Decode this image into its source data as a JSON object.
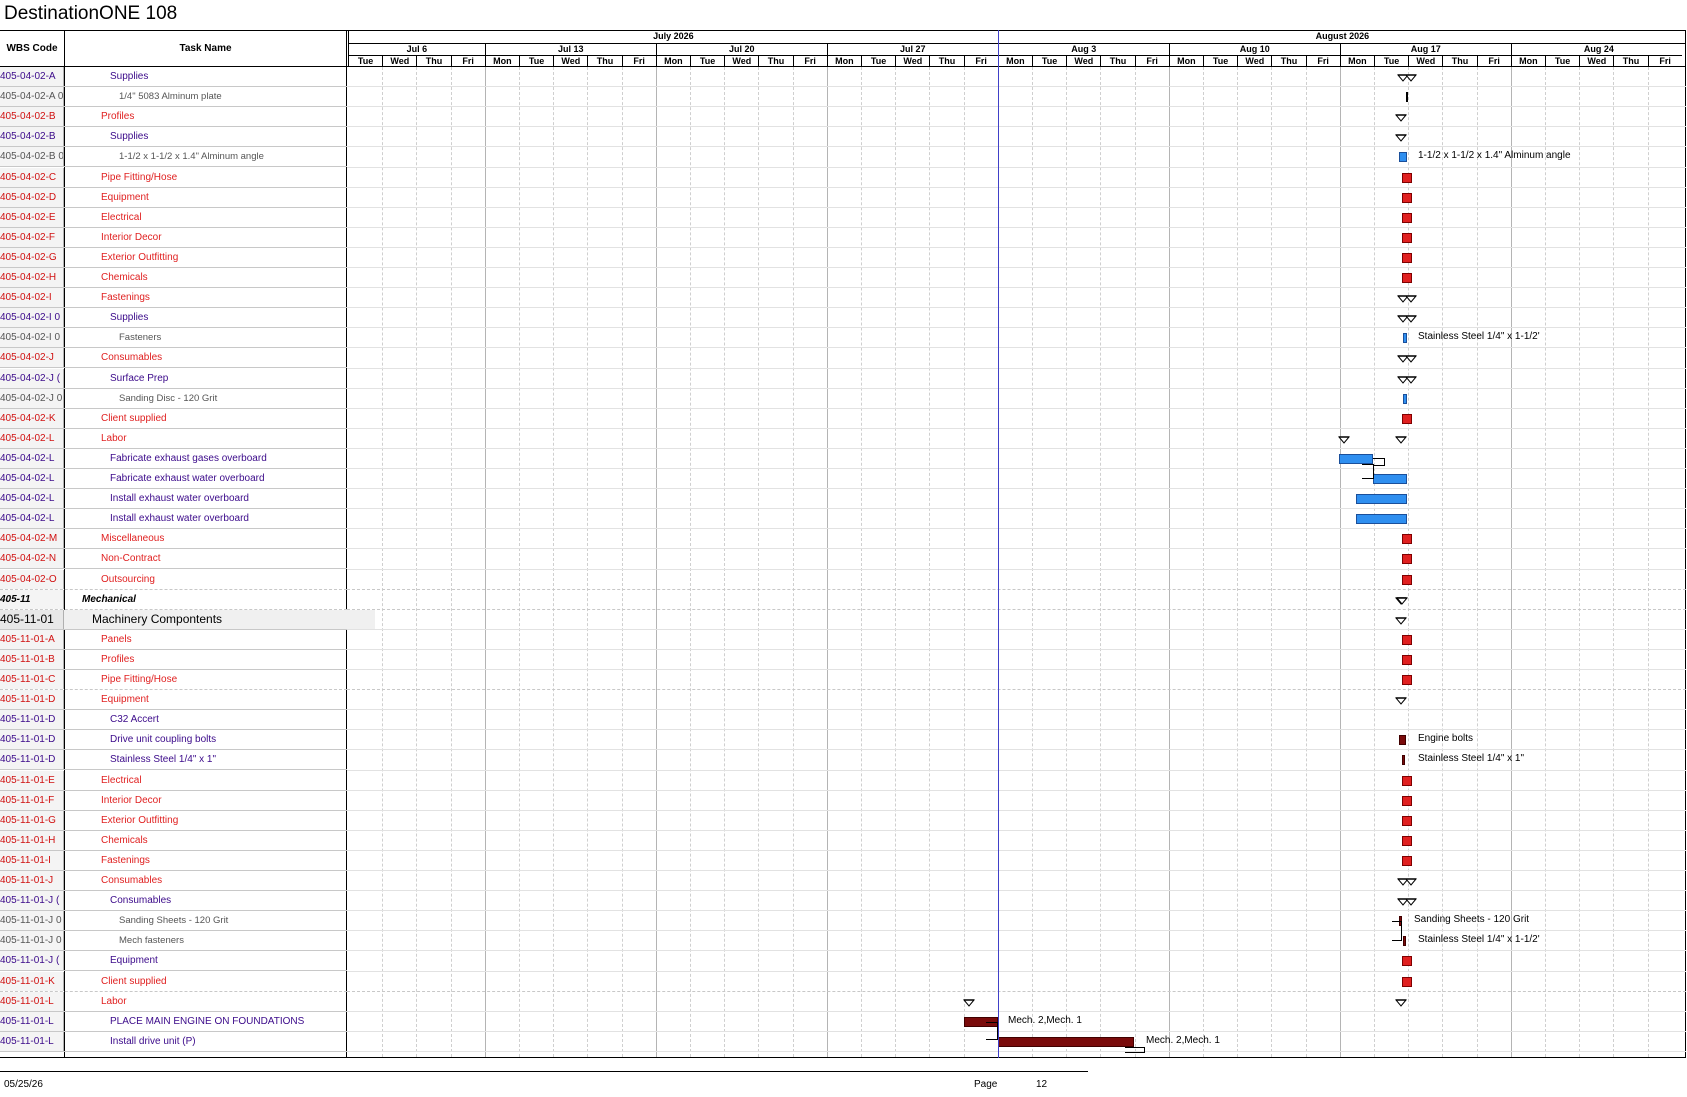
{
  "document": {
    "title": "DestinationONE 108"
  },
  "columns": {
    "wbs": "WBS Code",
    "task": "Task Name"
  },
  "timescale": {
    "months": [
      "July 2026",
      "August 2026"
    ],
    "weeks": [
      "Jul 6",
      "Jul 13",
      "Jul 20",
      "Jul 27",
      "Aug 3",
      "Aug 10",
      "Aug 17",
      "Aug 24"
    ],
    "days": [
      "Tue",
      "Wed",
      "Thu",
      "Fri",
      "Mon",
      "Tue",
      "Wed",
      "Thu",
      "Fri",
      "Mon",
      "Tue",
      "Wed",
      "Thu",
      "Fri",
      "Mon",
      "Tue",
      "Wed",
      "Thu",
      "Fri",
      "Mon",
      "Tue",
      "Wed",
      "Thu",
      "Fri",
      "Mon",
      "Tue",
      "Wed",
      "Thu",
      "Fri",
      "Mon",
      "Tue",
      "Wed",
      "Thu",
      "Fri",
      "Mon",
      "Tue",
      "Wed",
      "Thu",
      "Fri"
    ]
  },
  "colors": {
    "red_task": "#e02020",
    "purple_task": "#3b0a8a",
    "gray_task": "#555555",
    "blue_bar": "#2f8ff0",
    "dark_red_bar": "#7a0b0b",
    "today_line": "#4040c8"
  },
  "rows": [
    {
      "wbs": "405-04-02-A",
      "name": "Supplies",
      "style": "purple",
      "lvl": 2
    },
    {
      "wbs": "405-04-02-A 0",
      "name": "1/4\" 5083 Alminum plate",
      "style": "gray",
      "lvl": 3
    },
    {
      "wbs": "405-04-02-B",
      "name": "Profiles",
      "style": "red",
      "lvl": 1
    },
    {
      "wbs": "405-04-02-B",
      "name": "Supplies",
      "style": "purple",
      "lvl": 2
    },
    {
      "wbs": "405-04-02-B 0",
      "name": "1-1/2 x 1-1/2 x 1.4\" Alminum angle",
      "style": "gray",
      "lvl": 3
    },
    {
      "wbs": "405-04-02-C",
      "name": "Pipe Fitting/Hose",
      "style": "red",
      "lvl": 1
    },
    {
      "wbs": "405-04-02-D",
      "name": "Equipment",
      "style": "red",
      "lvl": 1
    },
    {
      "wbs": "405-04-02-E",
      "name": "Electrical",
      "style": "red",
      "lvl": 1
    },
    {
      "wbs": "405-04-02-F",
      "name": "Interior Decor",
      "style": "red",
      "lvl": 1
    },
    {
      "wbs": "405-04-02-G",
      "name": "Exterior Outfitting",
      "style": "red",
      "lvl": 1
    },
    {
      "wbs": "405-04-02-H",
      "name": "Chemicals",
      "style": "red",
      "lvl": 1
    },
    {
      "wbs": "405-04-02-I",
      "name": "Fastenings",
      "style": "red",
      "lvl": 1
    },
    {
      "wbs": "405-04-02-I 0",
      "name": "Supplies",
      "style": "purple",
      "lvl": 2
    },
    {
      "wbs": "405-04-02-I 0",
      "name": "Fasteners",
      "style": "gray",
      "lvl": 3
    },
    {
      "wbs": "405-04-02-J",
      "name": "Consumables",
      "style": "red",
      "lvl": 1
    },
    {
      "wbs": "405-04-02-J (",
      "name": "Surface Prep",
      "style": "purple",
      "lvl": 2
    },
    {
      "wbs": "405-04-02-J 0",
      "name": "Sanding Disc - 120 Grit",
      "style": "gray",
      "lvl": 3
    },
    {
      "wbs": "405-04-02-K",
      "name": "Client supplied",
      "style": "red",
      "lvl": 1
    },
    {
      "wbs": "405-04-02-L",
      "name": "Labor",
      "style": "red",
      "lvl": 1
    },
    {
      "wbs": "405-04-02-L",
      "name": "Fabricate exhaust gases overboard",
      "style": "purple",
      "lvl": 2
    },
    {
      "wbs": "405-04-02-L",
      "name": "Fabricate exhaust water overboard",
      "style": "purple",
      "lvl": 2
    },
    {
      "wbs": "405-04-02-L",
      "name": "Install exhaust water overboard",
      "style": "purple",
      "lvl": 2
    },
    {
      "wbs": "405-04-02-L",
      "name": "Install exhaust water overboard",
      "style": "purple",
      "lvl": 2
    },
    {
      "wbs": "405-04-02-M",
      "name": "Miscellaneous",
      "style": "red",
      "lvl": 1
    },
    {
      "wbs": "405-04-02-N",
      "name": "Non-Contract",
      "style": "red",
      "lvl": 1
    },
    {
      "wbs": "405-04-02-O",
      "name": "Outsourcing",
      "style": "red",
      "lvl": 1
    },
    {
      "wbs": "405-11",
      "name": "Mechanical",
      "style": "bolditalic",
      "lvl": 0
    },
    {
      "wbs": "405-11-01",
      "name": "Machinery Compontents",
      "style": "large",
      "lvl": 0
    },
    {
      "wbs": "405-11-01-A",
      "name": "Panels",
      "style": "red",
      "lvl": 1
    },
    {
      "wbs": "405-11-01-B",
      "name": "Profiles",
      "style": "red",
      "lvl": 1
    },
    {
      "wbs": "405-11-01-C",
      "name": "Pipe Fitting/Hose",
      "style": "red",
      "lvl": 1
    },
    {
      "wbs": "405-11-01-D",
      "name": "Equipment",
      "style": "red",
      "lvl": 1
    },
    {
      "wbs": "405-11-01-D",
      "name": "C32 Accert",
      "style": "purple",
      "lvl": 2
    },
    {
      "wbs": "405-11-01-D",
      "name": "Drive unit coupling bolts",
      "style": "purple",
      "lvl": 2
    },
    {
      "wbs": "405-11-01-D",
      "name": "Stainless Steel 1/4\" x 1\"",
      "style": "purple",
      "lvl": 2
    },
    {
      "wbs": "405-11-01-E",
      "name": "Electrical",
      "style": "red",
      "lvl": 1
    },
    {
      "wbs": "405-11-01-F",
      "name": "Interior Decor",
      "style": "red",
      "lvl": 1
    },
    {
      "wbs": "405-11-01-G",
      "name": "Exterior Outfitting",
      "style": "red",
      "lvl": 1
    },
    {
      "wbs": "405-11-01-H",
      "name": "Chemicals",
      "style": "red",
      "lvl": 1
    },
    {
      "wbs": "405-11-01-I",
      "name": "Fastenings",
      "style": "red",
      "lvl": 1
    },
    {
      "wbs": "405-11-01-J",
      "name": "Consumables",
      "style": "red",
      "lvl": 1
    },
    {
      "wbs": "405-11-01-J (",
      "name": "Consumables",
      "style": "purple",
      "lvl": 2
    },
    {
      "wbs": "405-11-01-J 0",
      "name": "Sanding Sheets - 120 Grit",
      "style": "gray",
      "lvl": 3
    },
    {
      "wbs": "405-11-01-J 0",
      "name": "Mech fasteners",
      "style": "gray",
      "lvl": 3
    },
    {
      "wbs": "405-11-01-J (",
      "name": "Equipment",
      "style": "purple",
      "lvl": 2
    },
    {
      "wbs": "405-11-01-K",
      "name": "Client supplied",
      "style": "red",
      "lvl": 1
    },
    {
      "wbs": "405-11-01-L",
      "name": "Labor",
      "style": "red",
      "lvl": 1
    },
    {
      "wbs": "405-11-01-L",
      "name": "PLACE MAIN ENGINE ON FOUNDATIONS",
      "style": "purple",
      "lvl": 2
    },
    {
      "wbs": "405-11-01-L",
      "name": "Install drive unit (P)",
      "style": "purple",
      "lvl": 2
    }
  ],
  "bar_labels": {
    "angle": "1-1/2 x 1-1/2 x 1.4\" Alminum angle",
    "fasteners": "Stainless Steel 1/4\" x 1-1/2'",
    "engine_bolts": "Engine bolts",
    "ss_1in": "Stainless Steel 1/4\" x 1\"",
    "sanding": "Sanding Sheets - 120 Grit",
    "mech_fast": "Stainless Steel 1/4\" x 1-1/2'",
    "engine": "Mech. 2,Mech. 1",
    "drive": "Mech. 2,Mech. 1"
  },
  "footer": {
    "date": "05/25/26",
    "page_label": "Page",
    "page_number": "12"
  }
}
